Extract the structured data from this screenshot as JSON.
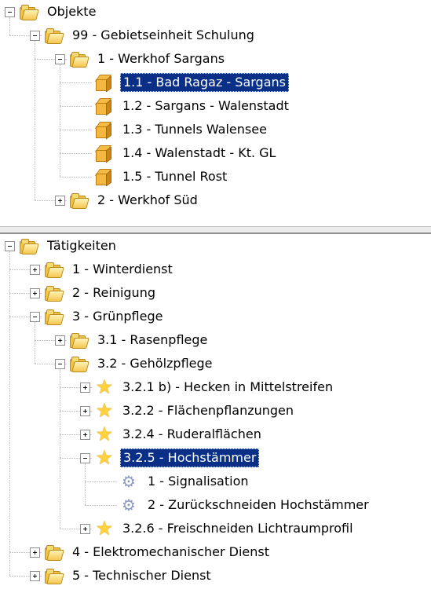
{
  "panels": [
    {
      "name": "objects",
      "tree": [
        {
          "label": "Objekte",
          "icon": "folder-icon",
          "expanded": true,
          "children": [
            {
              "label": "99 - Gebietseinheit Schulung",
              "icon": "folder-icon",
              "expanded": true,
              "children": [
                {
                  "label": "1 - Werkhof Sargans",
                  "icon": "folder-icon",
                  "expanded": true,
                  "children": [
                    {
                      "label": "1.1 - Bad Ragaz - Sargans",
                      "icon": "box-icon",
                      "selected": true
                    },
                    {
                      "label": "1.2 - Sargans - Walenstadt",
                      "icon": "box-icon"
                    },
                    {
                      "label": "1.3 - Tunnels Walensee",
                      "icon": "box-icon"
                    },
                    {
                      "label": "1.4 - Walenstadt - Kt. GL",
                      "icon": "box-icon"
                    },
                    {
                      "label": "1.5 - Tunnel Rost",
                      "icon": "box-icon"
                    }
                  ]
                },
                {
                  "label": "2 - Werkhof Süd",
                  "icon": "folder-icon",
                  "expanded": false,
                  "hasChildren": true
                }
              ]
            }
          ]
        }
      ]
    },
    {
      "name": "tasks",
      "tree": [
        {
          "label": "Tätigkeiten",
          "icon": "folder-icon",
          "expanded": true,
          "children": [
            {
              "label": "1 - Winterdienst",
              "icon": "folder-icon",
              "expanded": false,
              "hasChildren": true
            },
            {
              "label": "2 - Reinigung",
              "icon": "folder-icon",
              "expanded": false,
              "hasChildren": true
            },
            {
              "label": "3 - Grünpflege",
              "icon": "folder-icon",
              "expanded": true,
              "children": [
                {
                  "label": "3.1 - Rasenpflege",
                  "icon": "folder-icon",
                  "expanded": false,
                  "hasChildren": true
                },
                {
                  "label": "3.2 - Gehölzpflege",
                  "icon": "folder-icon",
                  "expanded": true,
                  "children": [
                    {
                      "label": "3.2.1 b) - Hecken in Mittelstreifen",
                      "icon": "star-icon",
                      "expanded": false,
                      "hasChildren": true
                    },
                    {
                      "label": "3.2.2 - Flächenpflanzungen",
                      "icon": "star-icon",
                      "expanded": false,
                      "hasChildren": true
                    },
                    {
                      "label": "3.2.4 - Ruderalflächen",
                      "icon": "star-icon",
                      "expanded": false,
                      "hasChildren": true
                    },
                    {
                      "label": "3.2.5 - Hochstämmer",
                      "icon": "star-icon",
                      "expanded": true,
                      "selected": true,
                      "children": [
                        {
                          "label": "1 - Signalisation",
                          "icon": "gear-icon"
                        },
                        {
                          "label": "2 - Zurückschneiden Hochstämmer",
                          "icon": "gear-icon"
                        }
                      ]
                    },
                    {
                      "label": "3.2.6 - Freischneiden Lichtraumprofil",
                      "icon": "star-icon",
                      "expanded": false,
                      "hasChildren": true
                    }
                  ]
                }
              ]
            },
            {
              "label": "4 - Elektromechanischer Dienst",
              "icon": "folder-icon",
              "expanded": false,
              "hasChildren": true
            },
            {
              "label": "5 - Technischer Dienst",
              "icon": "folder-icon",
              "expanded": false,
              "hasChildren": true
            }
          ]
        }
      ]
    }
  ]
}
